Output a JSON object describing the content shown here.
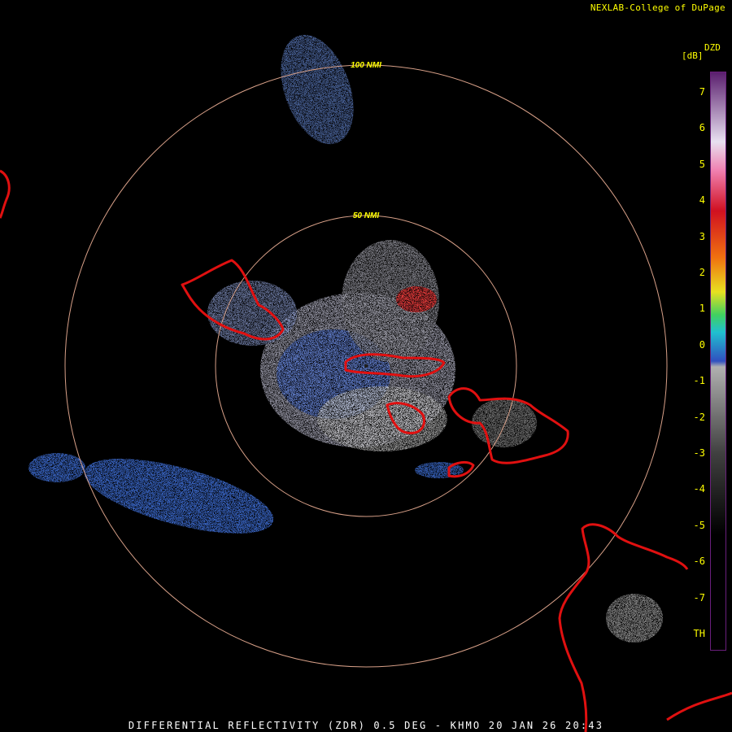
{
  "credit": "NEXLAB-College of DuPage",
  "caption": "DIFFERENTIAL REFLECTIVITY (ZDR) 0.5 DEG - KHMO 20 JAN 26 20:43",
  "legend": {
    "product": "DZD",
    "unit": "[dB]",
    "ticks": [
      {
        "label": "7",
        "value": 7
      },
      {
        "label": "6",
        "value": 6
      },
      {
        "label": "5",
        "value": 5
      },
      {
        "label": "4",
        "value": 4
      },
      {
        "label": "3",
        "value": 3
      },
      {
        "label": "2",
        "value": 2
      },
      {
        "label": "1",
        "value": 1
      },
      {
        "label": "0",
        "value": 0
      },
      {
        "label": "-1",
        "value": -1
      },
      {
        "label": "-2",
        "value": -2
      },
      {
        "label": "-3",
        "value": -3
      },
      {
        "label": "-4",
        "value": -4
      },
      {
        "label": "-5",
        "value": -5
      },
      {
        "label": "-6",
        "value": -6
      },
      {
        "label": "-7",
        "value": -7
      },
      {
        "label": "TH",
        "value": -8
      }
    ],
    "colors": {
      "top": "#5a1f6e",
      "light": "#e8e0f0",
      "pink": "#f080b0",
      "red": "#d01020",
      "orange": "#f07010",
      "yellow": "#e8e020",
      "green": "#40d060",
      "cyan": "#20c0d0",
      "blue": "#3050c0",
      "gray": "#b0b0b0",
      "dark": "#404040",
      "bottom": "#000000"
    }
  },
  "range_rings": [
    {
      "label": "100 NMI",
      "nmi": 100
    },
    {
      "label": "50 NMI",
      "nmi": 50
    }
  ],
  "ring_color": "#d8a088",
  "coast_color": "#e01010"
}
